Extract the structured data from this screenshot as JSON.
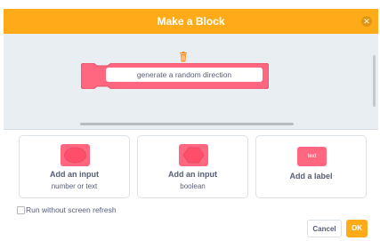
{
  "dialog": {
    "title": "Make a Block",
    "close_icon": "close-icon"
  },
  "block": {
    "name_value": "generate a random direction",
    "delete_icon": "trash-icon"
  },
  "options": [
    {
      "title": "Add an input",
      "subtitle": "number or text",
      "icon": "round-input-icon"
    },
    {
      "title": "Add an input",
      "subtitle": "boolean",
      "icon": "hexagon-input-icon"
    },
    {
      "title": "Add a label",
      "chip_text": "text",
      "icon": "label-icon"
    }
  ],
  "refresh": {
    "label": "Run without screen refresh",
    "checked": false
  },
  "buttons": {
    "cancel_label": "Cancel",
    "ok_label": "OK"
  },
  "colors": {
    "header": "#FFAB19",
    "block": "#FF6680",
    "workspace": "#E9EEF2",
    "text": "#575E75"
  }
}
